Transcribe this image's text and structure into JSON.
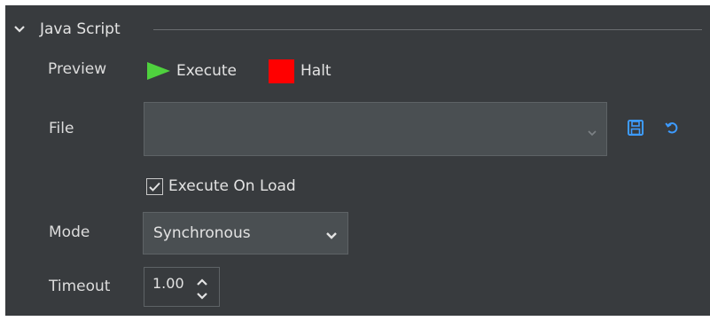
{
  "section": {
    "title": "Java Script",
    "icon": "chevron-down-icon"
  },
  "preview": {
    "label": "Preview",
    "execute_label": "Execute",
    "execute_icon": "play-icon",
    "execute_color": "#4fd13e",
    "halt_label": "Halt",
    "halt_icon": "stop-icon",
    "halt_color": "#ff0000"
  },
  "file": {
    "label": "File",
    "value": "",
    "save_icon": "save-icon",
    "reload_icon": "reload-icon",
    "icon_color": "#3d9bff"
  },
  "execute_on_load": {
    "label": "Execute On Load",
    "checked": true
  },
  "mode": {
    "label": "Mode",
    "value": "Synchronous"
  },
  "timeout": {
    "label": "Timeout",
    "value": "1.00"
  },
  "colors": {
    "panel_background": "#383b3e",
    "field_background": "#4a4f52",
    "text": "#e3e3e3"
  }
}
